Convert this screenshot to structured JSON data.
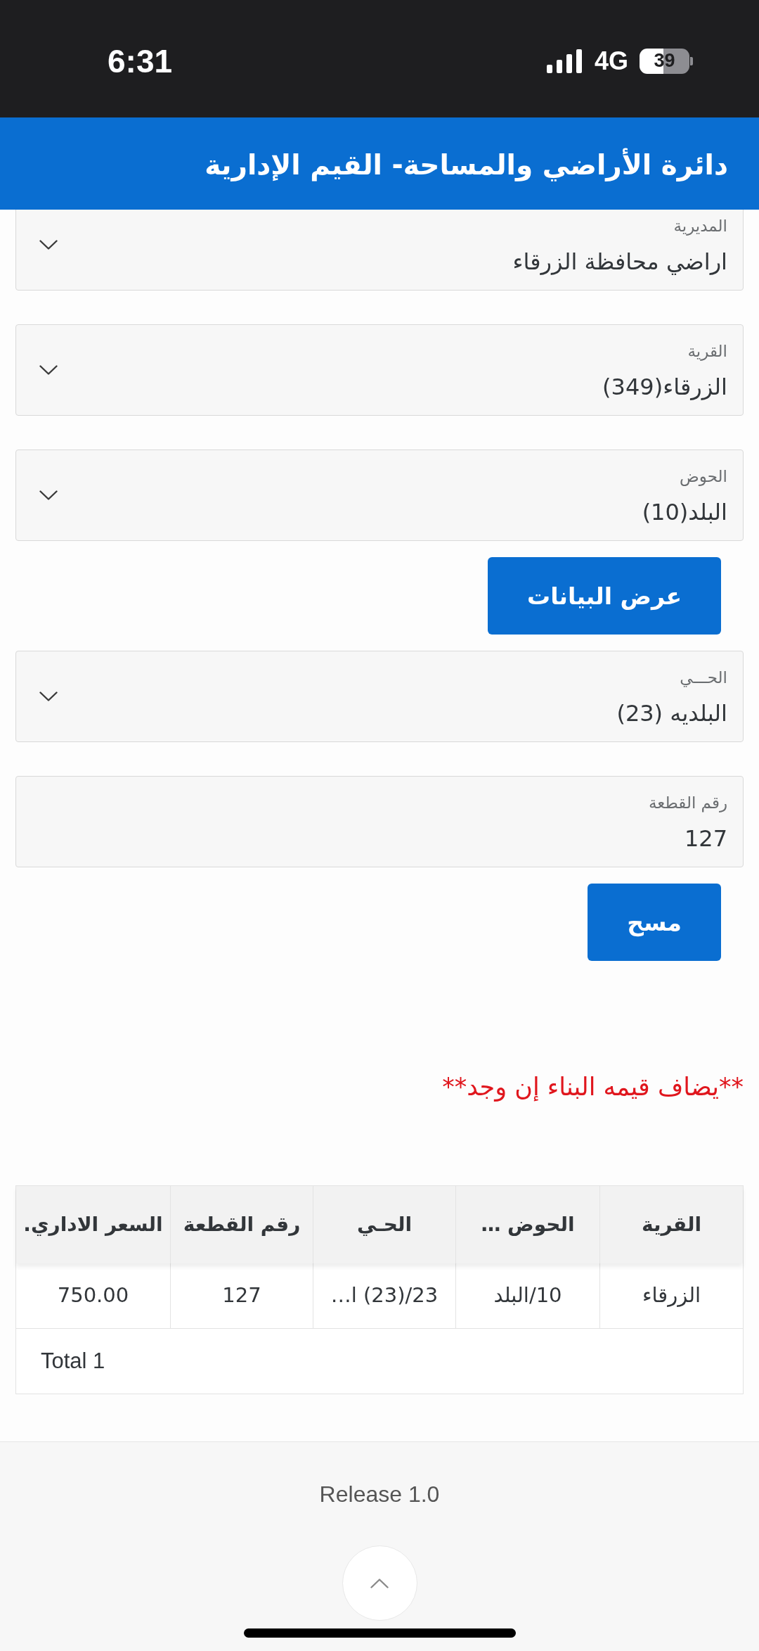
{
  "status_bar": {
    "time": "6:31",
    "network": "4G",
    "battery": "39"
  },
  "header": {
    "title": "دائرة الأراضي والمساحة- القيم الإدارية"
  },
  "form": [
    {
      "kind": "select",
      "label": "المديرية",
      "value": "اراضي محافظة الزرقاء"
    },
    {
      "kind": "select",
      "label": "القرية",
      "value": "الزرقاء(349)"
    },
    {
      "kind": "select",
      "label": "الحوض",
      "value": "البلد(10)"
    },
    {
      "kind": "button",
      "label": "عرض البيانات"
    },
    {
      "kind": "select",
      "label": "الحـــي",
      "value": "البلديه (23)"
    },
    {
      "kind": "input",
      "label": "رقم القطعة",
      "value": "127"
    },
    {
      "kind": "button",
      "label": "مسح"
    }
  ],
  "note": "**يضاف قيمه البناء إن وجد**",
  "table": {
    "columns": [
      "القرية",
      "الحوض …",
      "الحـي",
      "رقم القطعة",
      "السعر الاداري."
    ],
    "rows": [
      {
        "cells": [
          "الزرقاء",
          "10/البلد",
          "23/(23) ا…",
          "127",
          "750.00"
        ]
      }
    ],
    "total": "Total 1"
  },
  "footer": {
    "version": "Release 1.0"
  }
}
